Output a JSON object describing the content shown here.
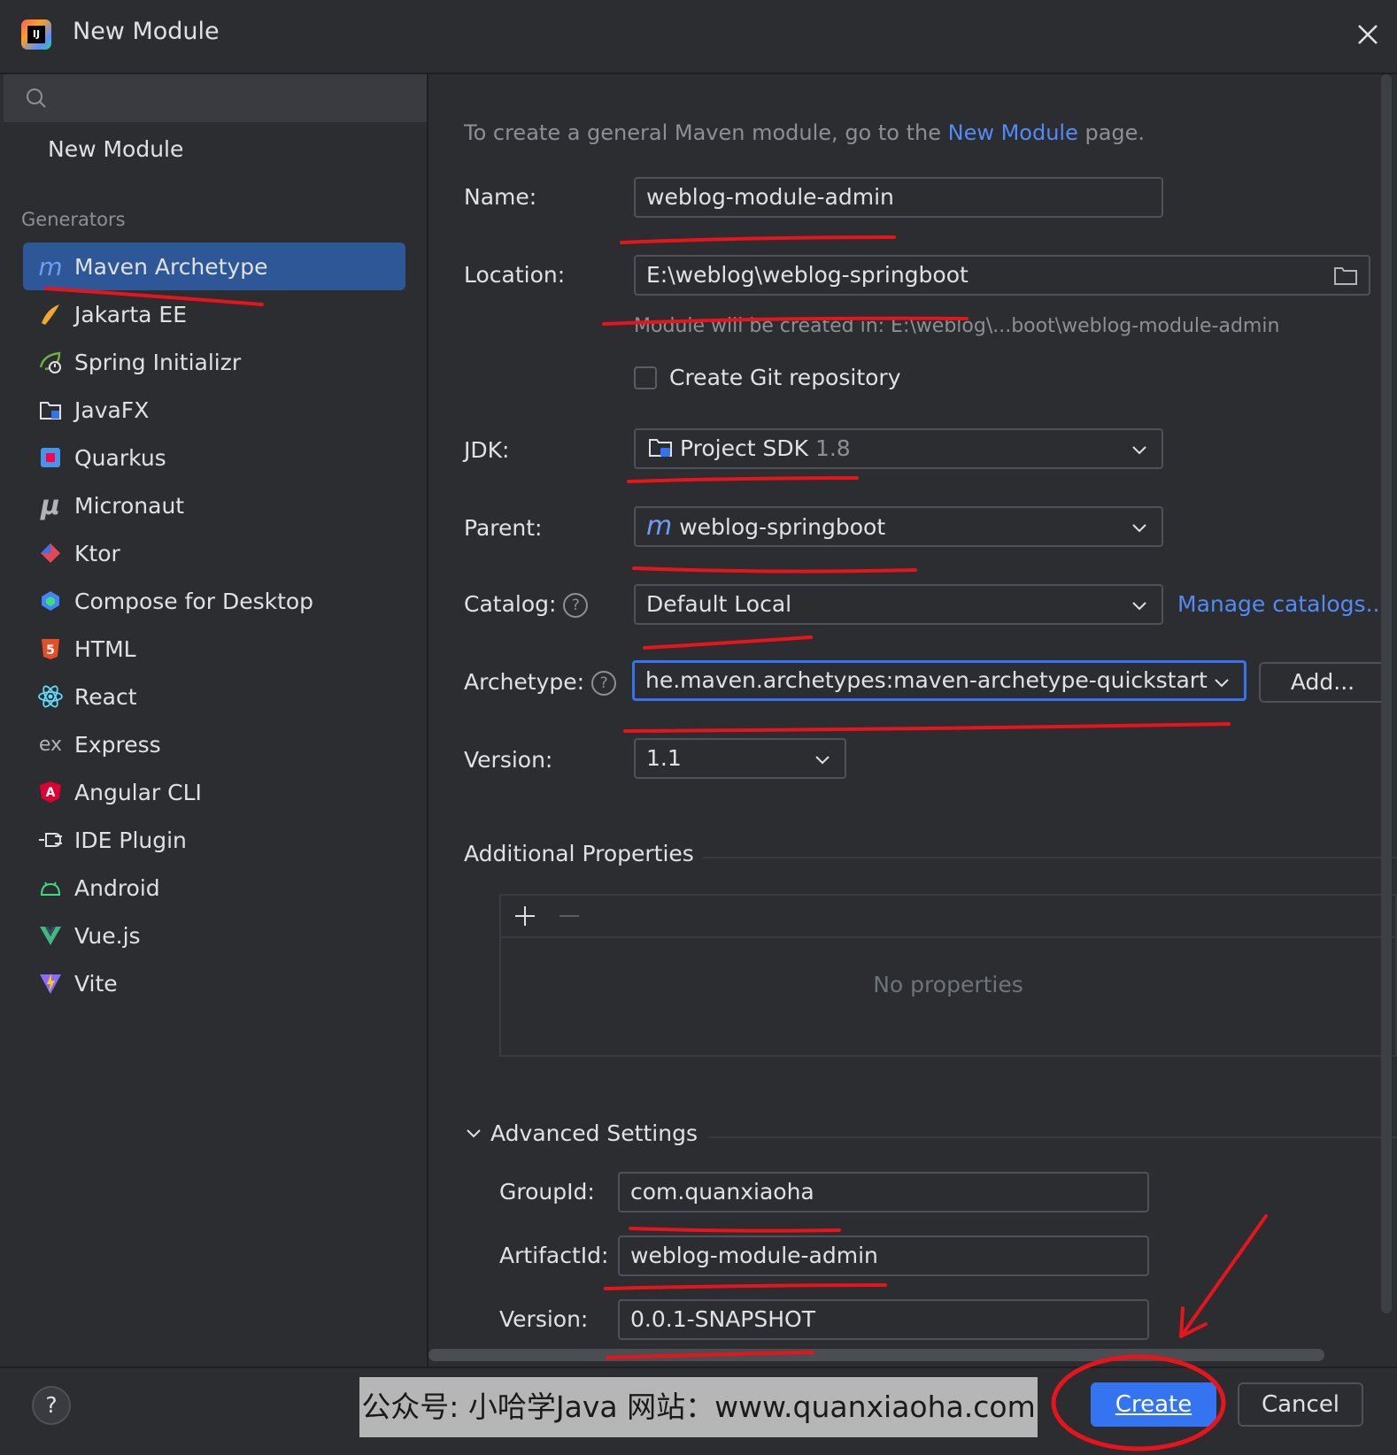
{
  "window": {
    "title": "New Module"
  },
  "sidebar": {
    "search_placeholder": "",
    "new_module": "New Module",
    "generators_label": "Generators",
    "items": [
      {
        "label": "Maven Archetype",
        "icon": "maven-icon",
        "selected": true
      },
      {
        "label": "Jakarta EE",
        "icon": "jakarta-icon"
      },
      {
        "label": "Spring Initializr",
        "icon": "spring-icon"
      },
      {
        "label": "JavaFX",
        "icon": "javafx-icon"
      },
      {
        "label": "Quarkus",
        "icon": "quarkus-icon"
      },
      {
        "label": "Micronaut",
        "icon": "micronaut-icon"
      },
      {
        "label": "Ktor",
        "icon": "ktor-icon"
      },
      {
        "label": "Compose for Desktop",
        "icon": "compose-icon"
      },
      {
        "label": "HTML",
        "icon": "html5-icon"
      },
      {
        "label": "React",
        "icon": "react-icon"
      },
      {
        "label": "Express",
        "icon": "express-icon"
      },
      {
        "label": "Angular CLI",
        "icon": "angular-icon"
      },
      {
        "label": "IDE Plugin",
        "icon": "plugin-icon"
      },
      {
        "label": "Android",
        "icon": "android-icon"
      },
      {
        "label": "Vue.js",
        "icon": "vue-icon"
      },
      {
        "label": "Vite",
        "icon": "vite-icon"
      }
    ]
  },
  "form": {
    "hint_prefix": "To create a general Maven module, go to the ",
    "hint_link": "New Module",
    "hint_suffix": " page.",
    "name_label": "Name:",
    "name_value": "weblog-module-admin",
    "location_label": "Location:",
    "location_value": "E:\\weblog\\weblog-springboot",
    "location_note": "Module will be created in: E:\\weblog\\...boot\\weblog-module-admin",
    "git_label": "Create Git repository",
    "jdk_label": "JDK:",
    "jdk_value": "Project SDK",
    "jdk_version": "1.8",
    "parent_label": "Parent:",
    "parent_value": "weblog-springboot",
    "catalog_label": "Catalog:",
    "catalog_value": "Default Local",
    "manage_catalogs": "Manage catalogs...",
    "archetype_label": "Archetype:",
    "archetype_value": "he.maven.archetypes:maven-archetype-quickstart",
    "add_button": "Add...",
    "version_label": "Version:",
    "version_value": "1.1",
    "additional_properties": "Additional Properties",
    "no_properties": "No properties",
    "advanced_settings": "Advanced Settings",
    "groupid_label": "GroupId:",
    "groupid_value": "com.quanxiaoha",
    "artifactid_label": "ArtifactId:",
    "artifactid_value": "weblog-module-admin",
    "adv_version_label": "Version:",
    "adv_version_value": "0.0.1-SNAPSHOT"
  },
  "footer": {
    "help": "?",
    "watermark": "公众号: 小哈学Java  网站：www.quanxiaoha.com",
    "create": "Create",
    "cancel": "Cancel"
  },
  "colors": {
    "accent": "#3574f0",
    "selection": "#2e5797",
    "annotation": "#e8141c"
  }
}
